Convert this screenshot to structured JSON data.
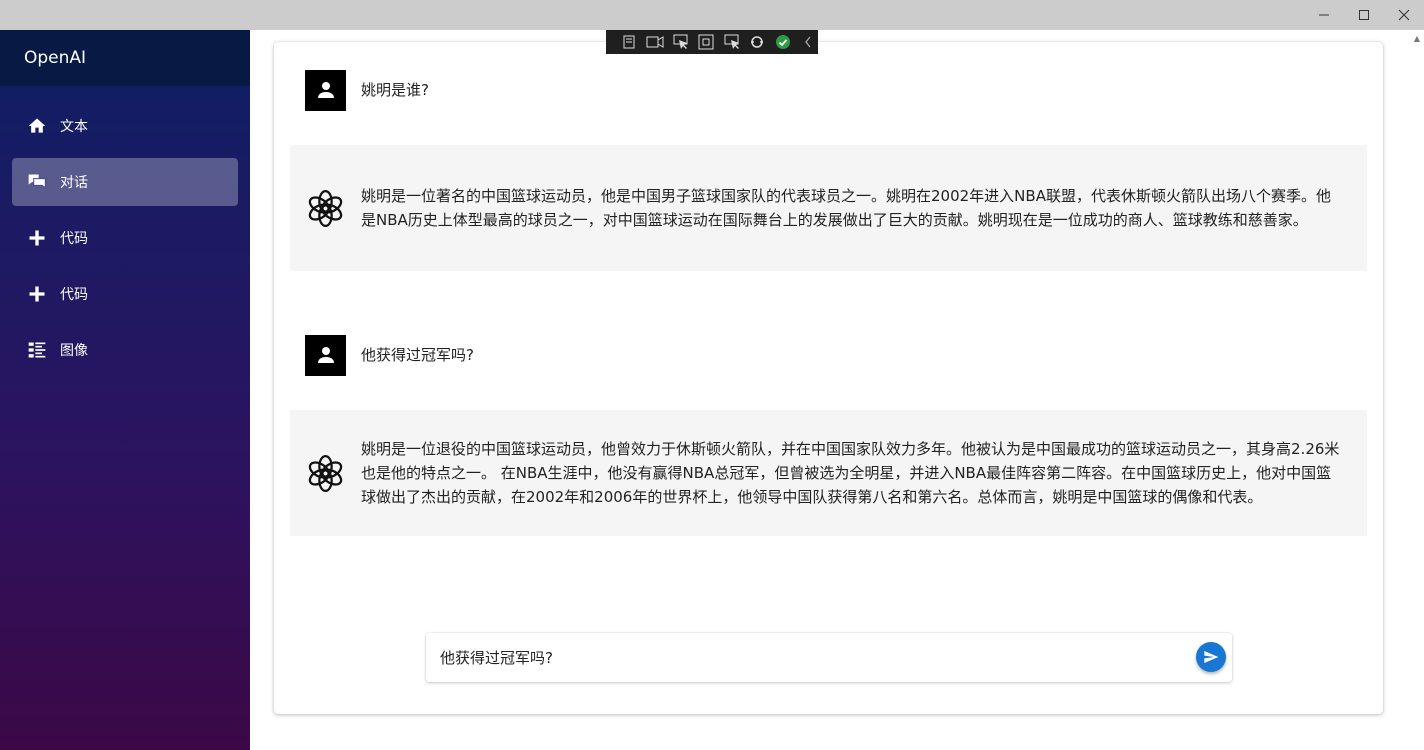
{
  "window": {
    "minimize_icon": "minimize-icon",
    "maximize_icon": "maximize-icon",
    "close_icon": "close-icon"
  },
  "sidebar": {
    "title": "OpenAI",
    "items": [
      {
        "label": "文本",
        "icon": "home-icon",
        "active": false
      },
      {
        "label": "对话",
        "icon": "chat-icon",
        "active": true
      },
      {
        "label": "代码",
        "icon": "plus-icon",
        "active": false
      },
      {
        "label": "代码",
        "icon": "plus-icon",
        "active": false
      },
      {
        "label": "图像",
        "icon": "grid-list-icon",
        "active": false
      }
    ]
  },
  "messages": [
    {
      "role": "user",
      "text": "姚明是谁?"
    },
    {
      "role": "assistant",
      "text": "姚明是一位著名的中国篮球运动员，他是中国男子篮球国家队的代表球员之一。姚明在2002年进入NBA联盟，代表休斯顿火箭队出场八个赛季。他是NBA历史上体型最高的球员之一，对中国篮球运动在国际舞台上的发展做出了巨大的贡献。姚明现在是一位成功的商人、篮球教练和慈善家。"
    },
    {
      "role": "user",
      "text": "他获得过冠军吗?"
    },
    {
      "role": "assistant",
      "text": "姚明是一位退役的中国篮球运动员，他曾效力于休斯顿火箭队，并在中国国家队效力多年。他被认为是中国最成功的篮球运动员之一，其身高2.26米也是他的特点之一。 在NBA生涯中，他没有赢得NBA总冠军，但曾被选为全明星，并进入NBA最佳阵容第二阵容。在中国篮球历史上，他对中国篮球做出了杰出的贡献，在2002年和2006年的世界杯上，他领导中国队获得第八名和第六名。总体而言，姚明是中国篮球的偶像和代表。"
    }
  ],
  "input": {
    "value": "他获得过冠军吗?",
    "send_icon": "send-icon"
  },
  "colors": {
    "accent": "#1976d2",
    "sidebar_header": "#081a44",
    "assistant_bg": "#f5f5f5"
  }
}
